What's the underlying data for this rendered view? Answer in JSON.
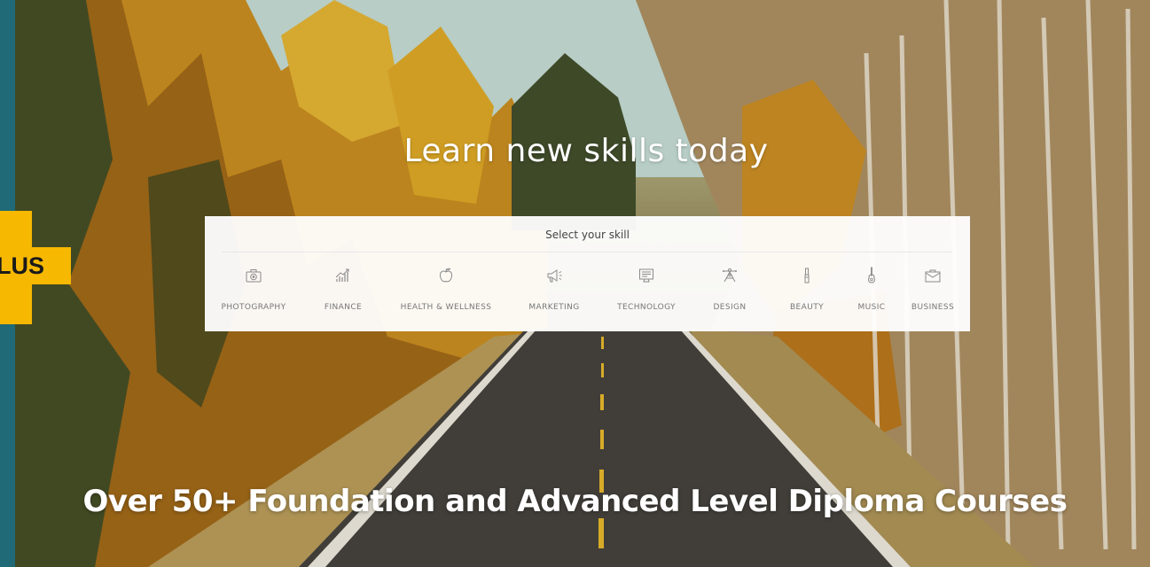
{
  "side_badge": {
    "label": "LUS"
  },
  "hero": {
    "title": "Learn new skills today"
  },
  "skills_panel": {
    "heading": "Select your skill",
    "items": [
      {
        "label": "PHOTOGRAPHY",
        "icon": "camera-icon"
      },
      {
        "label": "FINANCE",
        "icon": "growth-chart-icon"
      },
      {
        "label": "HEALTH & WELLNESS",
        "icon": "apple-icon"
      },
      {
        "label": "MARKETING",
        "icon": "megaphone-icon"
      },
      {
        "label": "TECHNOLOGY",
        "icon": "monitor-icon"
      },
      {
        "label": "DESIGN",
        "icon": "design-tool-icon"
      },
      {
        "label": "BEAUTY",
        "icon": "lipstick-icon"
      },
      {
        "label": "MUSIC",
        "icon": "guitar-icon"
      },
      {
        "label": "BUSINESS",
        "icon": "briefcase-icon"
      }
    ]
  },
  "banner": {
    "title": "Over 50+ Foundation and Advanced Level Diploma Courses"
  },
  "colors": {
    "accent_yellow": "#f6b800",
    "side_teal": "#1f6a76",
    "panel_bg": "#ffffff",
    "text_light": "#ffffff"
  }
}
